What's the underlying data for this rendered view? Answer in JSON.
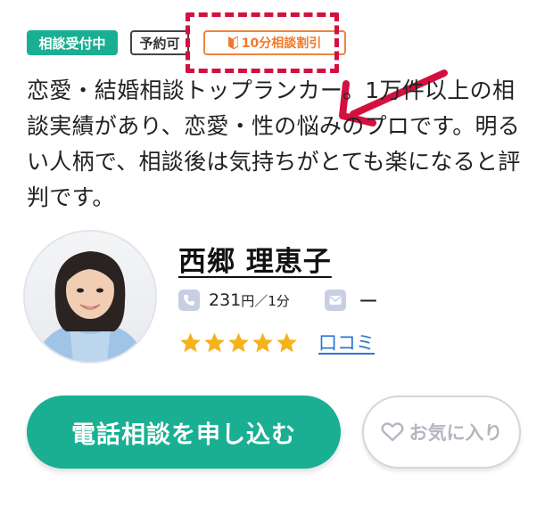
{
  "badges": {
    "status": "相談受付中",
    "reservation": "予約可",
    "discount": "10分相談割引"
  },
  "intro": "恋愛・結婚相談トップランカー。1万件以上の相談実績があり、恋愛・性の悩みのプロです。明るい人柄で、相談後は気持ちがとても楽になると評判です。",
  "profile": {
    "name": "西郷 理恵子",
    "price_amount": "231",
    "price_unit": "円／1分",
    "mail_value": "ー",
    "rating_stars": 5,
    "review_link": "口コミ"
  },
  "actions": {
    "call_button": "電話相談を申し込む",
    "favorite_button": "お気に入り"
  },
  "colors": {
    "accent_green": "#1aaf92",
    "discount_orange": "#ee7a2e",
    "highlight_red": "#d4103f",
    "star_yellow": "#f5b21b",
    "link_blue": "#2b75d6"
  },
  "icons": {
    "discount": "beginner-mark-icon",
    "phone": "phone-icon",
    "mail": "mail-icon",
    "favorite": "heart-icon",
    "star": "star-icon"
  }
}
